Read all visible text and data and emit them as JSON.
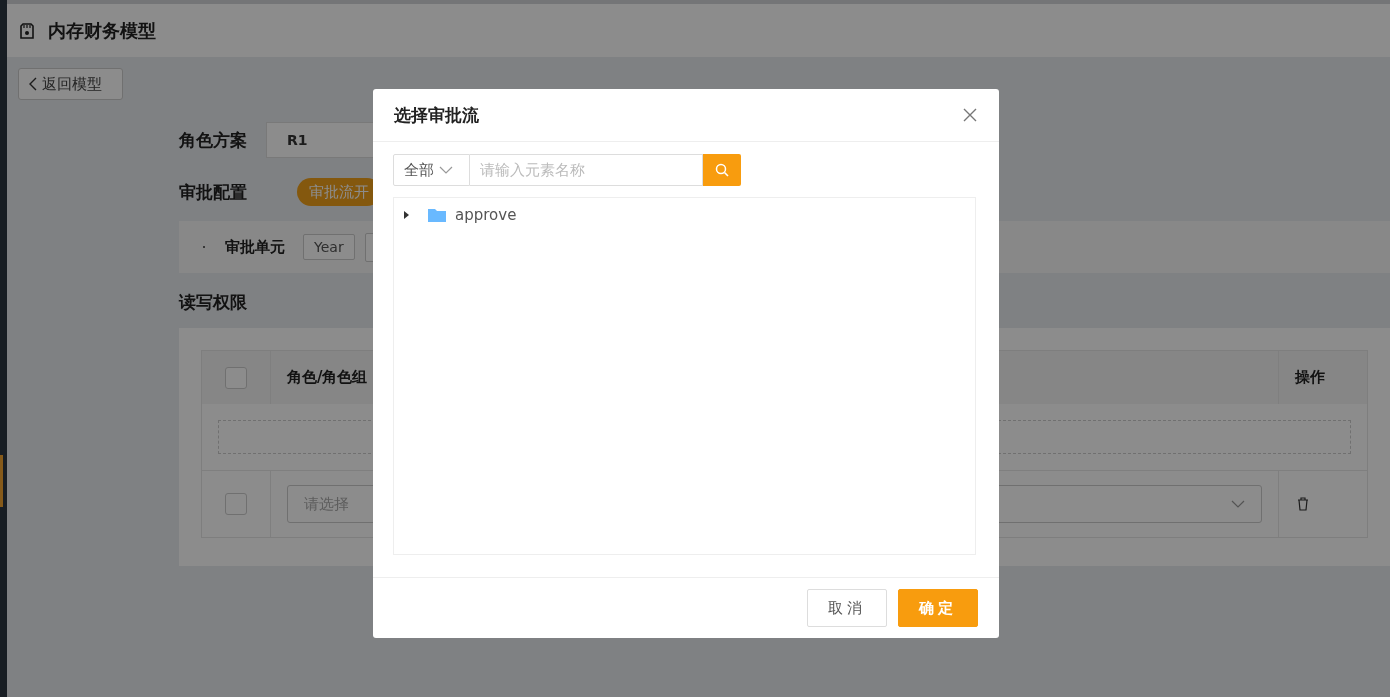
{
  "page": {
    "title": "内存财务模型",
    "back_button": "返回模型"
  },
  "form": {
    "role_scheme": {
      "label": "角色方案",
      "value": "R1"
    },
    "approval": {
      "label": "审批配置",
      "switch_text": "审批流开",
      "on": true
    },
    "approval_unit": {
      "label": "审批单元",
      "tags": [
        "Year"
      ]
    },
    "permissions": {
      "label": "读写权限",
      "header_checked": false,
      "columns": [
        "角色/角色组",
        "操作"
      ],
      "rows": [
        {
          "checked": false,
          "placeholder": "请选择"
        }
      ]
    }
  },
  "dialog": {
    "title": "选择审批流",
    "filter": "全部",
    "search": {
      "placeholder": "请输入元素名称"
    },
    "tree": [
      {
        "label": "approve",
        "expanded": false
      }
    ],
    "buttons": [
      {
        "label": "取消",
        "kind": "secondary"
      },
      {
        "label": "确定",
        "kind": "primary"
      }
    ]
  }
}
